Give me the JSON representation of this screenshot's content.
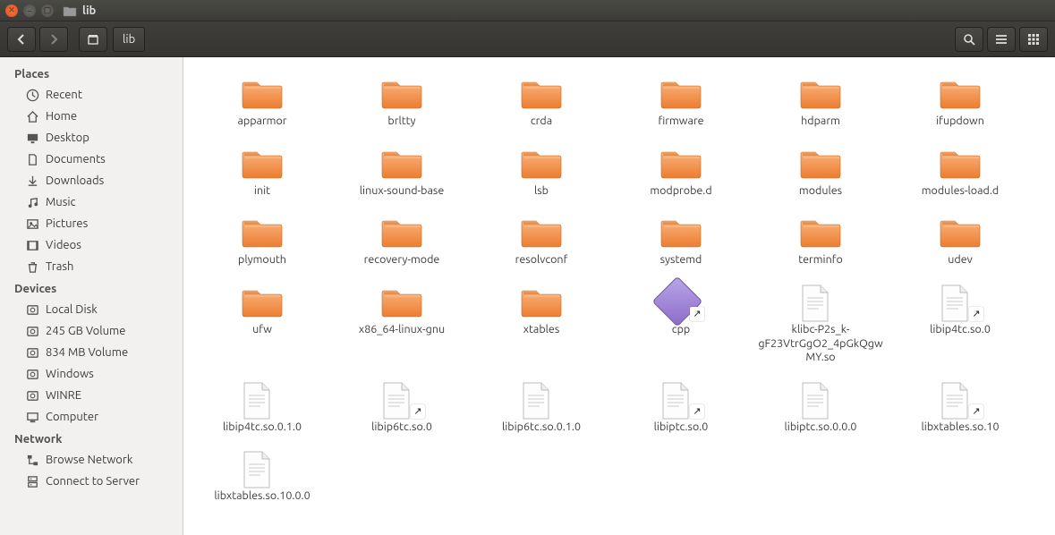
{
  "window": {
    "title": "lib"
  },
  "toolbar": {
    "path_label": "lib"
  },
  "sidebar": {
    "sections": [
      {
        "heading": "Places",
        "items": [
          {
            "icon": "clock-icon",
            "label": "Recent"
          },
          {
            "icon": "home-icon",
            "label": "Home"
          },
          {
            "icon": "desktop-icon",
            "label": "Desktop"
          },
          {
            "icon": "documents-icon",
            "label": "Documents"
          },
          {
            "icon": "downloads-icon",
            "label": "Downloads"
          },
          {
            "icon": "music-icon",
            "label": "Music"
          },
          {
            "icon": "pictures-icon",
            "label": "Pictures"
          },
          {
            "icon": "videos-icon",
            "label": "Videos"
          },
          {
            "icon": "trash-icon",
            "label": "Trash"
          }
        ]
      },
      {
        "heading": "Devices",
        "items": [
          {
            "icon": "disk-icon",
            "label": "Local Disk"
          },
          {
            "icon": "disk-icon",
            "label": "245 GB Volume"
          },
          {
            "icon": "disk-icon",
            "label": "834 MB Volume"
          },
          {
            "icon": "disk-icon",
            "label": "Windows"
          },
          {
            "icon": "disk-icon",
            "label": "WINRE"
          },
          {
            "icon": "computer-icon",
            "label": "Computer"
          }
        ]
      },
      {
        "heading": "Network",
        "items": [
          {
            "icon": "network-icon",
            "label": "Browse Network"
          },
          {
            "icon": "server-icon",
            "label": "Connect to Server"
          }
        ]
      }
    ]
  },
  "files": [
    {
      "name": "apparmor",
      "type": "folder"
    },
    {
      "name": "brltty",
      "type": "folder"
    },
    {
      "name": "crda",
      "type": "folder"
    },
    {
      "name": "firmware",
      "type": "folder"
    },
    {
      "name": "hdparm",
      "type": "folder"
    },
    {
      "name": "ifupdown",
      "type": "folder"
    },
    {
      "name": "init",
      "type": "folder"
    },
    {
      "name": "linux-sound-base",
      "type": "folder"
    },
    {
      "name": "lsb",
      "type": "folder"
    },
    {
      "name": "modprobe.d",
      "type": "folder"
    },
    {
      "name": "modules",
      "type": "folder"
    },
    {
      "name": "modules-load.d",
      "type": "folder"
    },
    {
      "name": "plymouth",
      "type": "folder"
    },
    {
      "name": "recovery-mode",
      "type": "folder"
    },
    {
      "name": "resolvconf",
      "type": "folder"
    },
    {
      "name": "systemd",
      "type": "folder"
    },
    {
      "name": "terminfo",
      "type": "folder"
    },
    {
      "name": "udev",
      "type": "folder"
    },
    {
      "name": "ufw",
      "type": "folder"
    },
    {
      "name": "x86_64-linux-gnu",
      "type": "folder"
    },
    {
      "name": "xtables",
      "type": "folder"
    },
    {
      "name": "cpp",
      "type": "link-app"
    },
    {
      "name": "klibc-P2s_k-gF23VtrGgO2_4pGkQgwMY.so",
      "type": "file"
    },
    {
      "name": "libip4tc.so.0",
      "type": "link-file"
    },
    {
      "name": "libip4tc.so.0.1.0",
      "type": "file"
    },
    {
      "name": "libip6tc.so.0",
      "type": "link-file"
    },
    {
      "name": "libip6tc.so.0.1.0",
      "type": "file"
    },
    {
      "name": "libiptc.so.0",
      "type": "link-file"
    },
    {
      "name": "libiptc.so.0.0.0",
      "type": "file"
    },
    {
      "name": "libxtables.so.10",
      "type": "link-file"
    },
    {
      "name": "libxtables.so.10.0.0",
      "type": "file"
    }
  ]
}
